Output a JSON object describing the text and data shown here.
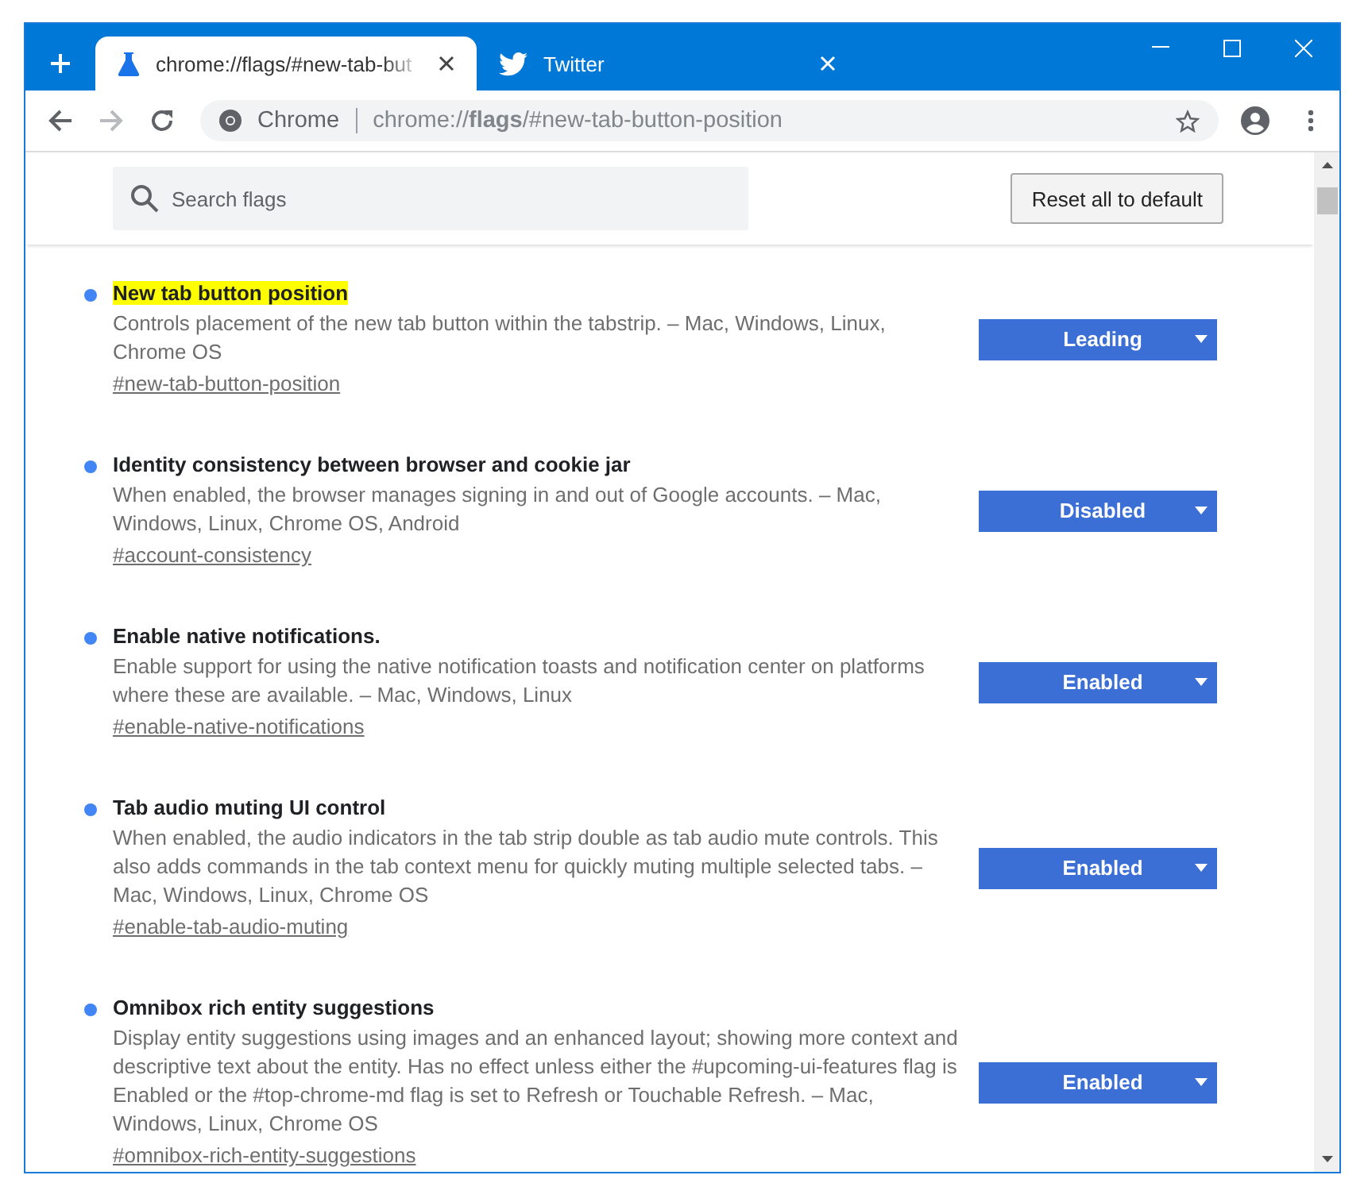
{
  "tabs": [
    {
      "title": "chrome://flags/#new-tab-but",
      "selected": true
    },
    {
      "title": "Twitter",
      "selected": false
    }
  ],
  "toolbar": {
    "forward_disabled": true,
    "site_label": "Chrome",
    "url": "chrome://**flags**/#new-tab-button-position"
  },
  "search": {
    "placeholder": "Search flags"
  },
  "reset_button": "Reset all to default",
  "flags": [
    {
      "title": "New tab button position",
      "highlighted": true,
      "description": "Controls placement of the new tab button within the tabstrip. – Mac, Windows, Linux, Chrome OS",
      "link": "#new-tab-button-position",
      "value": "Leading"
    },
    {
      "title": "Identity consistency between browser and cookie jar",
      "highlighted": false,
      "description": "When enabled, the browser manages signing in and out of Google accounts. – Mac, Windows, Linux, Chrome OS, Android",
      "link": "#account-consistency",
      "value": "Disabled"
    },
    {
      "title": "Enable native notifications.",
      "highlighted": false,
      "description": "Enable support for using the native notification toasts and notification center on platforms where these are available. – Mac, Windows, Linux",
      "link": "#enable-native-notifications",
      "value": "Enabled"
    },
    {
      "title": "Tab audio muting UI control",
      "highlighted": false,
      "description": "When enabled, the audio indicators in the tab strip double as tab audio mute controls. This also adds commands in the tab context menu for quickly muting multiple selected tabs. – Mac, Windows, Linux, Chrome OS",
      "link": "#enable-tab-audio-muting",
      "value": "Enabled"
    },
    {
      "title": "Omnibox rich entity suggestions",
      "highlighted": false,
      "description": "Display entity suggestions using images and an enhanced layout; showing more context and descriptive text about the entity. Has no effect unless either the #upcoming-ui-features flag is Enabled or the #top-chrome-md flag is set to Refresh or Touchable Refresh. – Mac, Windows, Linux, Chrome OS",
      "link": "#omnibox-rich-entity-suggestions",
      "value": "Enabled"
    }
  ]
}
